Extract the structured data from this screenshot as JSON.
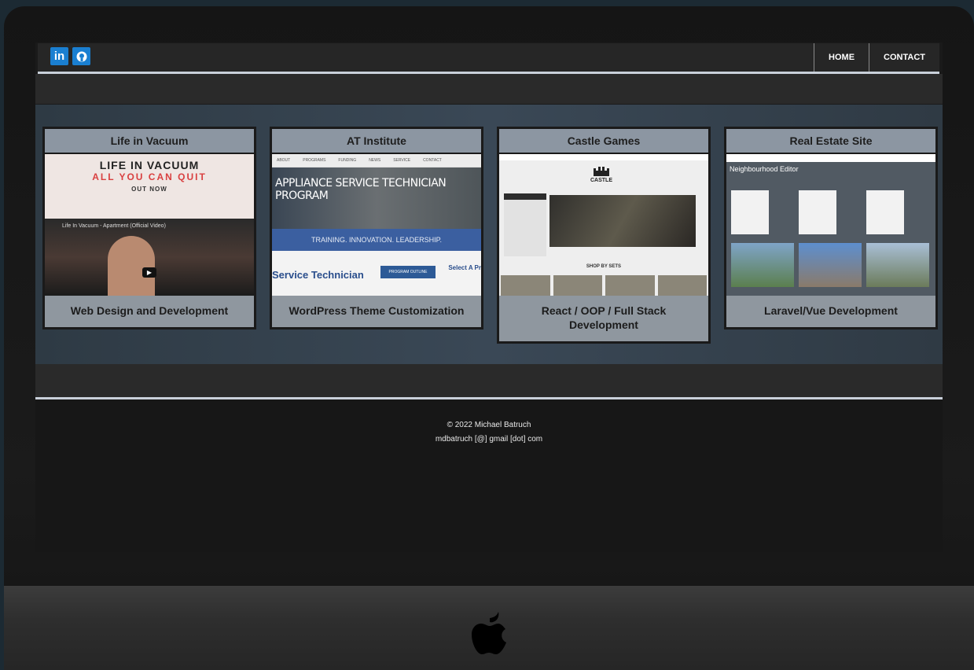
{
  "nav": {
    "home": "HOME",
    "contact": "CONTACT",
    "linkedin_icon": "linkedin-icon",
    "github_icon": "github-icon"
  },
  "projects": [
    {
      "title": "Life in Vacuum",
      "caption": "Web Design and Development"
    },
    {
      "title": "AT Institute",
      "caption": "WordPress Theme Customization"
    },
    {
      "title": "Castle Games",
      "caption": "React / OOP / Full Stack Development"
    },
    {
      "title": "Real Estate Site",
      "caption": "Laravel/Vue Development"
    }
  ],
  "thumbs": {
    "vacuum": {
      "headline": "LIFE IN VACUUM",
      "subline": "ALL YOU CAN QUIT",
      "out_now": "OUT NOW",
      "video_title": "Life In Vacuum - Apartment (Official Video)"
    },
    "at": {
      "nav": [
        "ABOUT",
        "PROGRAMS",
        "FUNDING",
        "NEWS",
        "SERVICE",
        "CONTACT"
      ],
      "hero": "APPLIANCE SERVICE TECHNICIAN PROGRAM",
      "band": "TRAINING. INNOVATION. LEADERSHIP.",
      "service": "Service Technician",
      "button": "PROGRAM OUTLINE",
      "select": "Select A Pr"
    },
    "castle": {
      "logo": "CASTLE",
      "shop": "SHOP BY SETS"
    },
    "realestate": {
      "title": "Neighbourhood Editor"
    }
  },
  "footer": {
    "copyright": "© 2022 Michael Batruch",
    "email": "mdbatruch [@] gmail [dot] com"
  },
  "colors": {
    "nav_bg": "#262626",
    "accent_line": "#c9d0da",
    "card_header": "#8c96a2",
    "card_body": "#8f979f",
    "projects_bg": "#3a4856"
  }
}
